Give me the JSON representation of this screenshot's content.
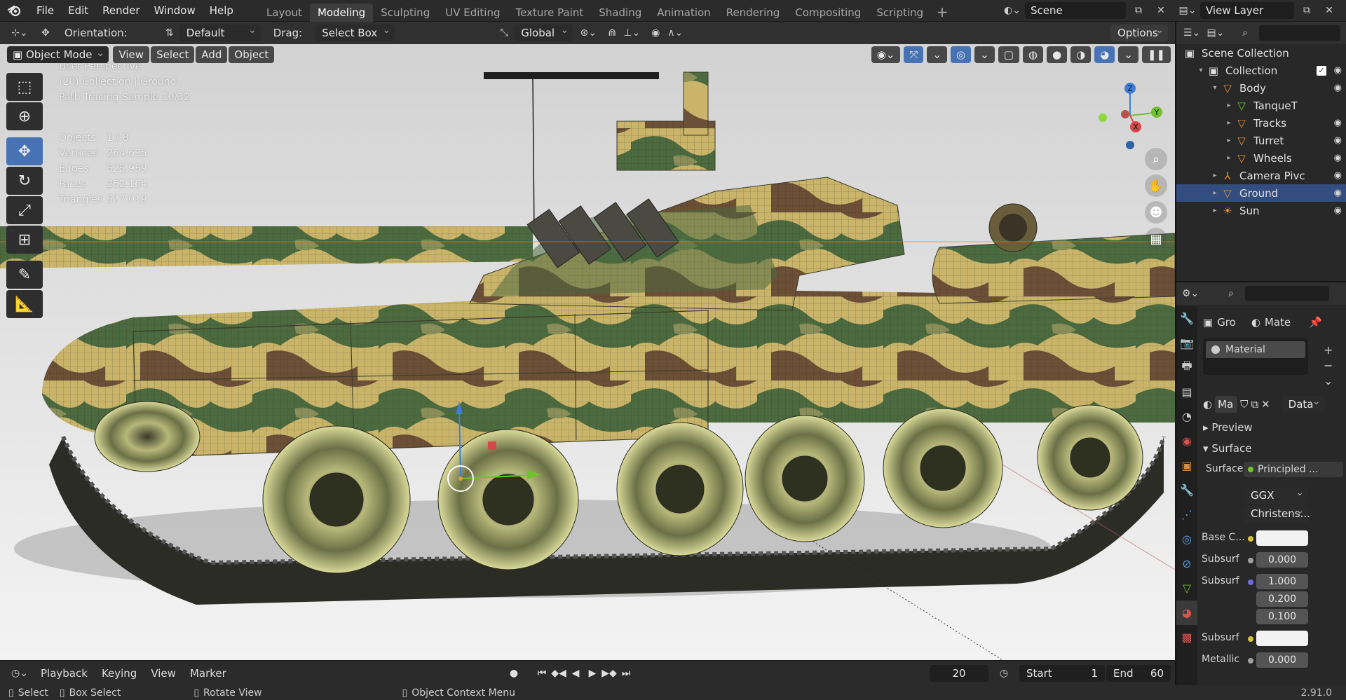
{
  "menus": [
    "File",
    "Edit",
    "Render",
    "Window",
    "Help"
  ],
  "workspace_tabs": [
    "Layout",
    "Modeling",
    "Sculpting",
    "UV Editing",
    "Texture Paint",
    "Shading",
    "Animation",
    "Rendering",
    "Compositing",
    "Scripting"
  ],
  "active_workspace": "Modeling",
  "scene_name": "Scene",
  "view_layer": "View Layer",
  "toolbar": {
    "orientation_label": "Orientation:",
    "orientation_value": "Default",
    "drag_label": "Drag:",
    "drag_value": "Select Box",
    "transform_orientation": "Global",
    "options_label": "Options"
  },
  "viewport_header": {
    "mode": "Object Mode",
    "view": "View",
    "select": "Select",
    "add": "Add",
    "object": "Object"
  },
  "overlay": {
    "perspective": "User Perspective",
    "collection": "(20) Collection | Ground",
    "sample": "Path Tracing Sample 10/32",
    "stats": [
      {
        "label": "Objects",
        "value": "1 / 8"
      },
      {
        "label": "Vertices",
        "value": "264,635"
      },
      {
        "label": "Edges",
        "value": "525,959"
      },
      {
        "label": "Faces",
        "value": "262,164"
      },
      {
        "label": "Triangles",
        "value": "527,019"
      }
    ]
  },
  "gizmo_axes": {
    "z": "Z",
    "y": "Y",
    "x": "X"
  },
  "outliner": {
    "root": "Scene Collection",
    "items": [
      {
        "label": "Collection",
        "icon": "collection-icon",
        "depth": 1,
        "selected": false
      },
      {
        "label": "Body",
        "icon": "mesh-icon",
        "depth": 2,
        "selected": false
      },
      {
        "label": "TanqueT",
        "icon": "mesh-data-icon",
        "depth": 3,
        "selected": false
      },
      {
        "label": "Tracks",
        "icon": "mesh-icon",
        "depth": 3,
        "selected": false
      },
      {
        "label": "Turret",
        "icon": "mesh-icon",
        "depth": 3,
        "selected": false
      },
      {
        "label": "Wheels",
        "icon": "mesh-icon",
        "depth": 3,
        "selected": false
      },
      {
        "label": "Camera Pivc",
        "icon": "armature-icon",
        "depth": 2,
        "selected": false
      },
      {
        "label": "Ground",
        "icon": "mesh-icon",
        "depth": 2,
        "selected": true
      },
      {
        "label": "Sun",
        "icon": "light-icon",
        "depth": 2,
        "selected": false
      }
    ]
  },
  "properties": {
    "object_short": "Gro",
    "material_short": "Mate",
    "slot_name": "Material",
    "material_field": "Ma",
    "link_mode": "Data",
    "panel_preview": "Preview",
    "panel_surface": "Surface",
    "surface_label": "Surface",
    "surface_value": "Principled ...",
    "distribution": "GGX",
    "subsurface_method": "Christens...",
    "rows": [
      {
        "label": "Base C...",
        "value": ""
      },
      {
        "label": "Subsurf",
        "value": "0.000"
      },
      {
        "label": "Subsurf",
        "value": "1.000"
      },
      {
        "label": "",
        "value": "0.200"
      },
      {
        "label": "",
        "value": "0.100"
      },
      {
        "label": "Subsurf",
        "value": ""
      },
      {
        "label": "Metallic",
        "value": "0.000"
      }
    ]
  },
  "timeline": {
    "playback": "Playback",
    "keying": "Keying",
    "view": "View",
    "marker": "Marker",
    "current_frame": "20",
    "start_label": "Start",
    "start_value": "1",
    "end_label": "End",
    "end_value": "60"
  },
  "statusbar": {
    "select": "Select",
    "box_select": "Box Select",
    "rotate_view": "Rotate View",
    "context_menu": "Object Context Menu",
    "version": "2.91.0"
  }
}
